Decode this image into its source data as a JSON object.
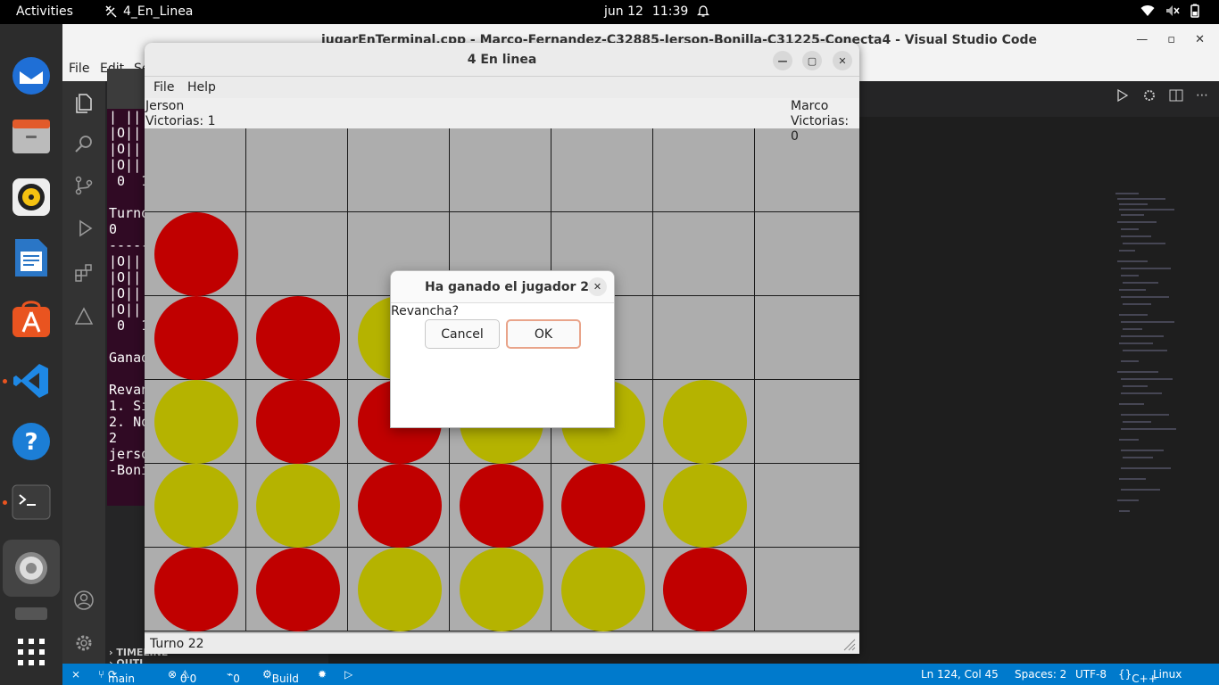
{
  "topbar": {
    "activities": "Activities",
    "app_name": "4_En_Linea",
    "date": "jun 12",
    "time": "11:39"
  },
  "vscode": {
    "title": "jugarEnTerminal.cpp - Marco-Fernandez-C32885-Jerson-Bonilla-C31225-Conecta4 - Visual Studio Code",
    "menu": [
      "File",
      "Edit",
      "Se"
    ],
    "terminal_lines": "| ||\n|O||\n|O||\n|O||\n 0  1\n\nTurno\n0\n-----\n|O||\n|O||\n|O||\n|O||\n 0  1\n\nGanad\n\nRevan\n1. Si\n2. No\n2\njerso\n-Boni",
    "side_labels": {
      "outline": "OUTL",
      "timeline": "TIMELINE"
    },
    "status": {
      "branch": "main",
      "errors": "0",
      "warnings": "0",
      "ports": "0",
      "build": "Build",
      "position": "Ln 124, Col 45",
      "spaces": "Spaces: 2",
      "encoding": "UTF-8",
      "language": "C++",
      "eol": "Linux"
    }
  },
  "game": {
    "title": "4 En linea",
    "menu": {
      "file": "File",
      "help": "Help"
    },
    "player1": {
      "name": "Jerson",
      "wins": "Victorias: 1"
    },
    "player2": {
      "name": "Marco",
      "wins": "Victorias: 0"
    },
    "status": "Turno 22",
    "colors": {
      "red": "#c00000",
      "yellow": "#b5b300",
      "board": "#adadad"
    },
    "board": [
      [
        "",
        "",
        "",
        "",
        "",
        "",
        ""
      ],
      [
        "R",
        "",
        "",
        "",
        "",
        "",
        ""
      ],
      [
        "R",
        "R",
        "Y",
        "",
        "",
        "",
        ""
      ],
      [
        "Y",
        "R",
        "R",
        "Y",
        "Y",
        "Y",
        ""
      ],
      [
        "Y",
        "Y",
        "R",
        "R",
        "R",
        "Y",
        ""
      ],
      [
        "R",
        "R",
        "Y",
        "Y",
        "Y",
        "R",
        ""
      ]
    ]
  },
  "dialog": {
    "title": "Ha ganado el jugador 2",
    "message": "Revancha?",
    "cancel": "Cancel",
    "ok": "OK"
  }
}
